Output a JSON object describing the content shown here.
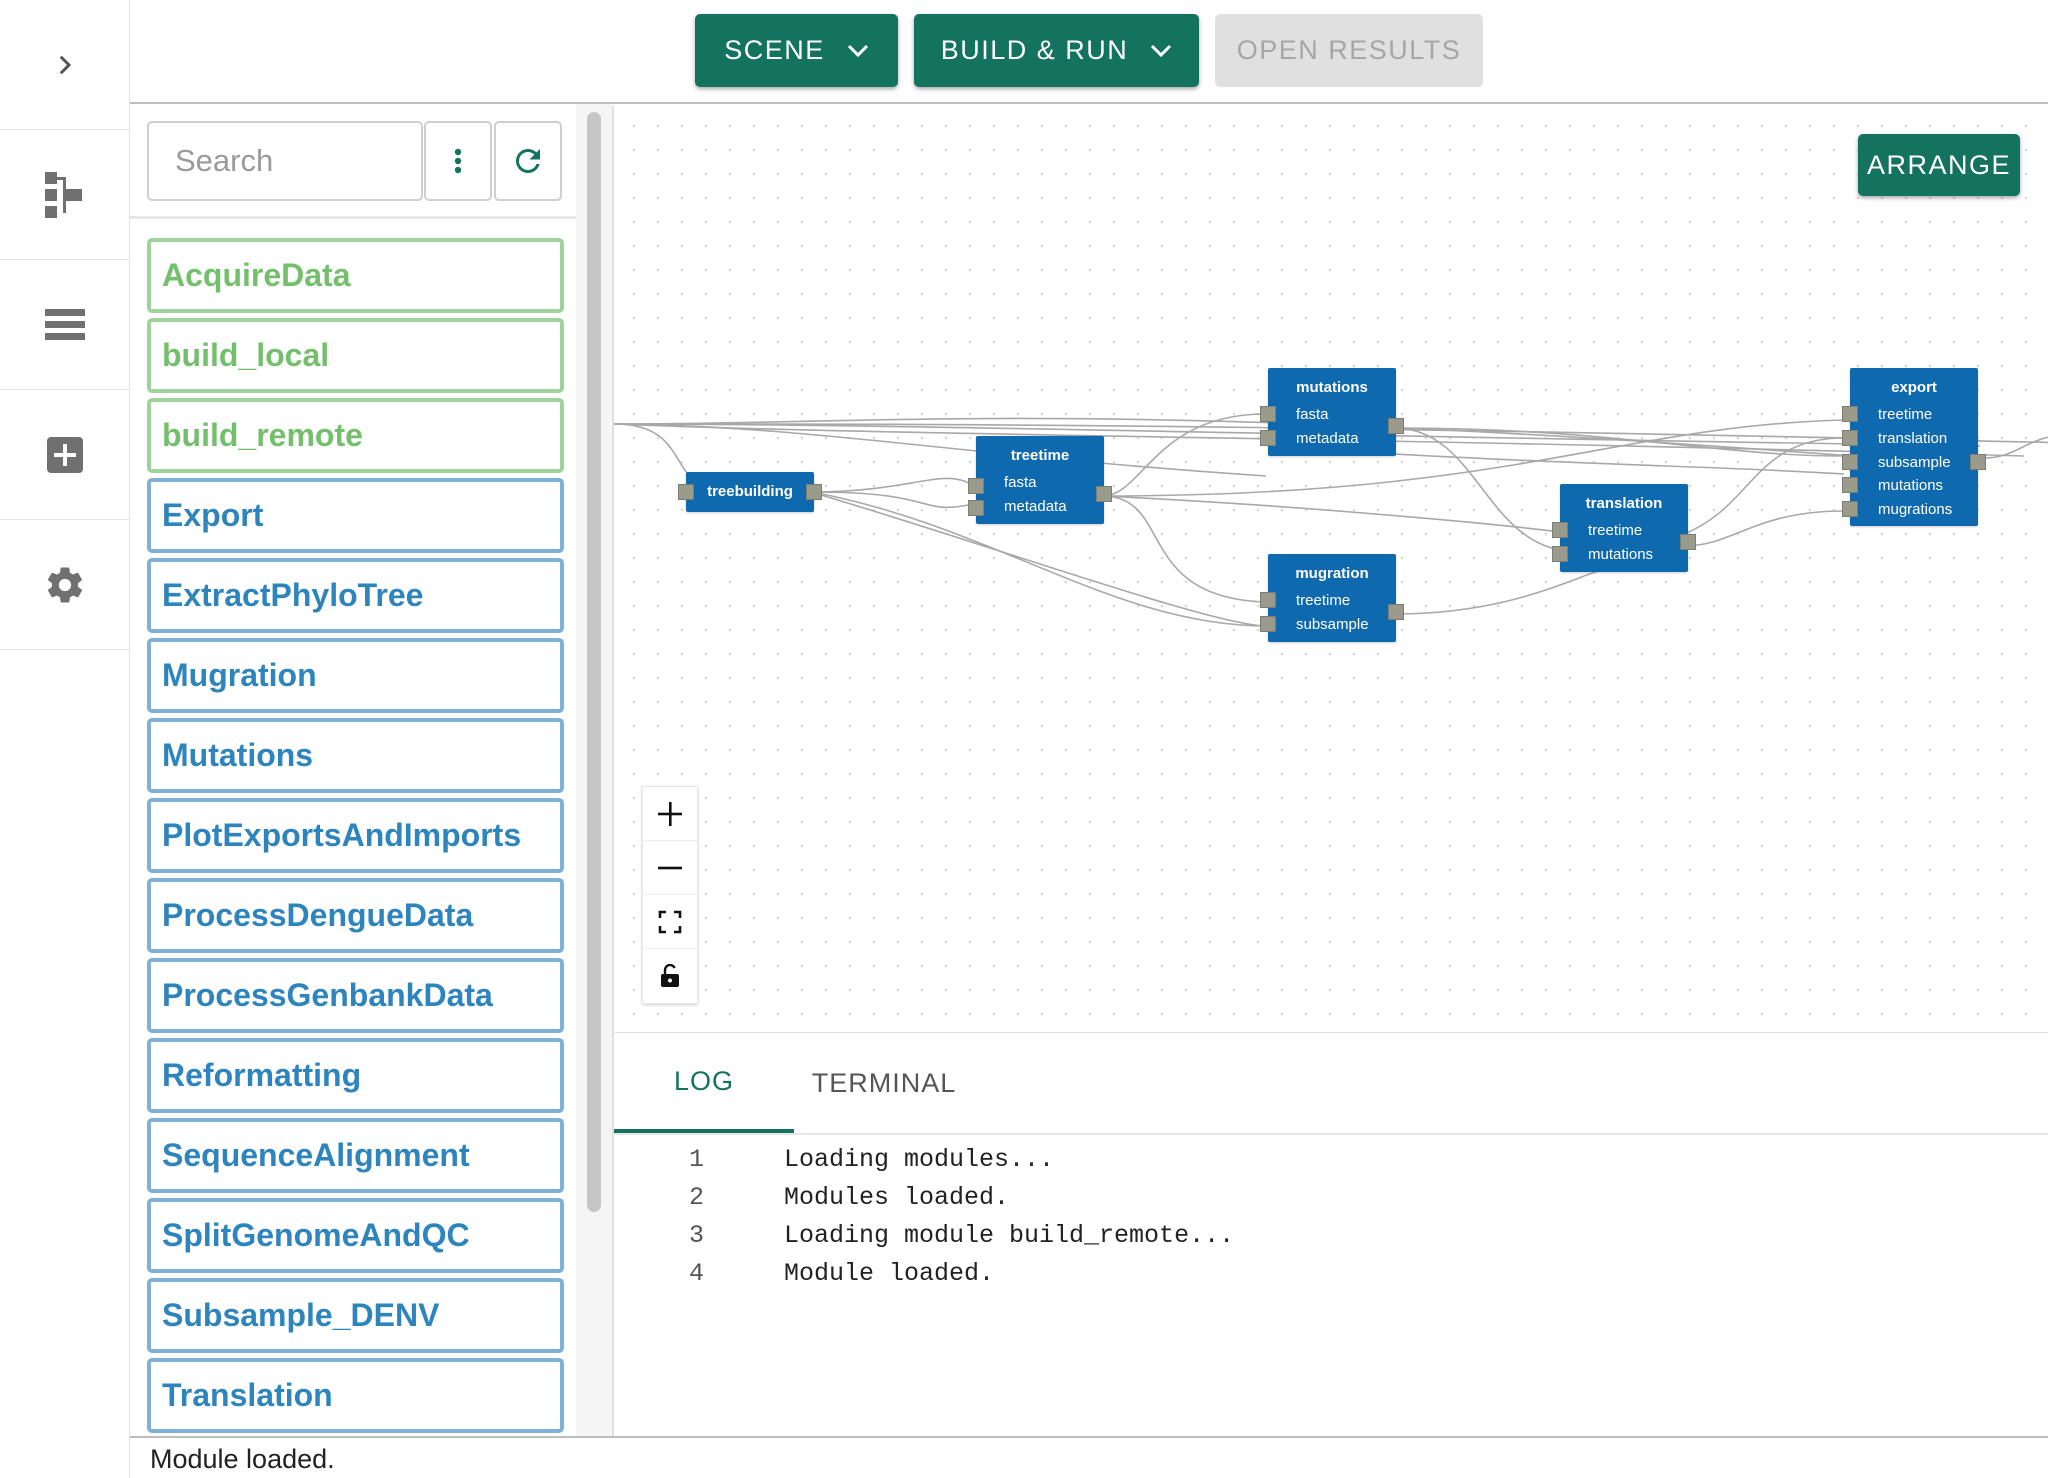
{
  "toolbar": {
    "scene_label": "SCENE",
    "build_label": "BUILD & RUN",
    "open_results_label": "OPEN RESULTS"
  },
  "panel": {
    "search_placeholder": "Search",
    "modules": [
      {
        "label": "AcquireData",
        "kind": "green"
      },
      {
        "label": "build_local",
        "kind": "green"
      },
      {
        "label": "build_remote",
        "kind": "green"
      },
      {
        "label": "Export",
        "kind": "blue"
      },
      {
        "label": "ExtractPhyloTree",
        "kind": "blue"
      },
      {
        "label": "Mugration",
        "kind": "blue"
      },
      {
        "label": "Mutations",
        "kind": "blue"
      },
      {
        "label": "PlotExportsAndImports",
        "kind": "blue"
      },
      {
        "label": "ProcessDengueData",
        "kind": "blue"
      },
      {
        "label": "ProcessGenbankData",
        "kind": "blue"
      },
      {
        "label": "Reformatting",
        "kind": "blue"
      },
      {
        "label": "SequenceAlignment",
        "kind": "blue"
      },
      {
        "label": "SplitGenomeAndQC",
        "kind": "blue"
      },
      {
        "label": "Subsample_DENV",
        "kind": "blue"
      },
      {
        "label": "Translation",
        "kind": "blue"
      }
    ]
  },
  "graph": {
    "arrange_label": "ARRANGE",
    "nodes": [
      {
        "id": "treebuilding",
        "title": "treebuilding",
        "ports": []
      },
      {
        "id": "treetime",
        "title": "treetime",
        "ports": [
          "fasta",
          "metadata"
        ]
      },
      {
        "id": "mutations",
        "title": "mutations",
        "ports": [
          "fasta",
          "metadata"
        ]
      },
      {
        "id": "mugration",
        "title": "mugration",
        "ports": [
          "treetime",
          "subsample"
        ]
      },
      {
        "id": "translation",
        "title": "translation",
        "ports": [
          "treetime",
          "mutations"
        ]
      },
      {
        "id": "export",
        "title": "export",
        "ports": [
          "treetime",
          "translation",
          "subsample",
          "mutations",
          "mugrations"
        ]
      }
    ]
  },
  "log": {
    "tab_log": "LOG",
    "tab_terminal": "TERMINAL",
    "lines": [
      {
        "n": "1",
        "text": "Loading modules..."
      },
      {
        "n": "2",
        "text": "Modules loaded."
      },
      {
        "n": "3",
        "text": "Loading module build_remote..."
      },
      {
        "n": "4",
        "text": "Module loaded."
      }
    ]
  },
  "status_text": "Module loaded.",
  "colors": {
    "accent": "#13735f",
    "node_blue": "#0f69ae",
    "module_blue": "#2e84bd",
    "module_green": "#74bf6c"
  },
  "icons": {
    "rail": [
      "chevron-right-icon",
      "tree-icon",
      "list-icon",
      "add-box-icon",
      "gear-icon"
    ]
  }
}
